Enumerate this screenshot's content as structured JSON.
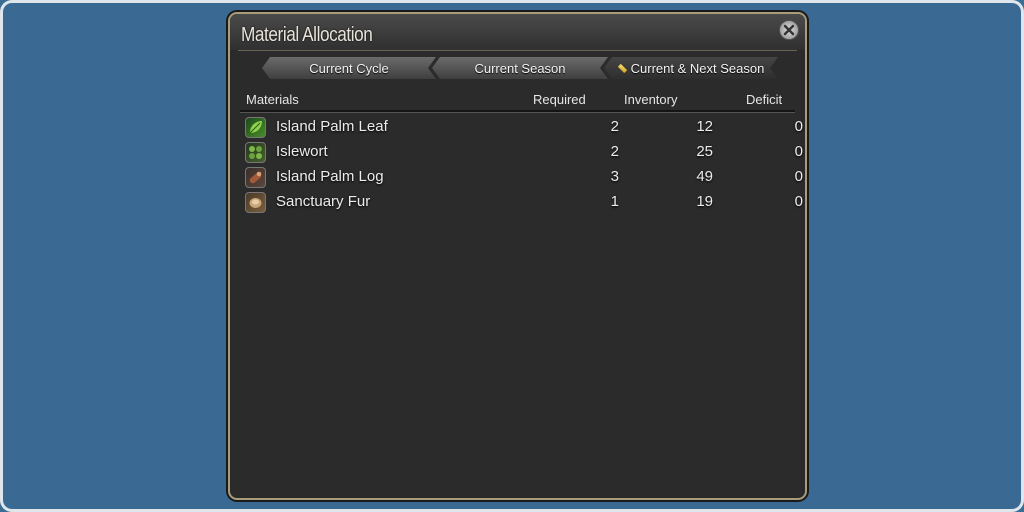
{
  "window": {
    "title": "Material Allocation"
  },
  "tabs": [
    {
      "label": "Current Cycle",
      "active": false
    },
    {
      "label": "Current Season",
      "active": false
    },
    {
      "label": "Current & Next Season",
      "active": true
    }
  ],
  "table": {
    "headers": {
      "materials": "Materials",
      "required": "Required",
      "inventory": "Inventory",
      "deficit": "Deficit"
    },
    "rows": [
      {
        "icon": "palm-leaf-icon",
        "name": "Island Palm Leaf",
        "required": "2",
        "inventory": "12",
        "deficit": "0"
      },
      {
        "icon": "islewort-icon",
        "name": "Islewort",
        "required": "2",
        "inventory": "25",
        "deficit": "0"
      },
      {
        "icon": "palm-log-icon",
        "name": "Island Palm Log",
        "required": "3",
        "inventory": "49",
        "deficit": "0"
      },
      {
        "icon": "fur-icon",
        "name": "Sanctuary Fur",
        "required": "1",
        "inventory": "19",
        "deficit": "0"
      }
    ]
  },
  "colors": {
    "background": "#3b6c94",
    "window_border": "#a99c7a",
    "panel": "#2b2b2b"
  }
}
